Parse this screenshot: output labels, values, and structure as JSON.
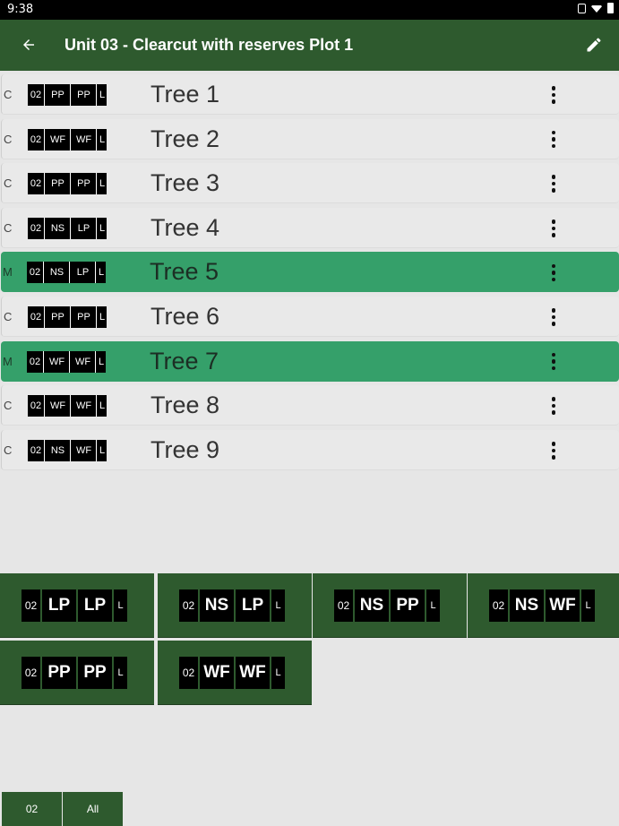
{
  "status_bar": {
    "time": "9:38"
  },
  "app_bar": {
    "title": "Unit 03 - Clearcut with reserves Plot 1"
  },
  "trees": [
    {
      "status": "C",
      "tags": [
        "02",
        "PP",
        "PP",
        "L"
      ],
      "name": "Tree 1",
      "selected": false
    },
    {
      "status": "C",
      "tags": [
        "02",
        "WF",
        "WF",
        "L"
      ],
      "name": "Tree 2",
      "selected": false
    },
    {
      "status": "C",
      "tags": [
        "02",
        "PP",
        "PP",
        "L"
      ],
      "name": "Tree 3",
      "selected": false
    },
    {
      "status": "C",
      "tags": [
        "02",
        "NS",
        "LP",
        "L"
      ],
      "name": "Tree 4",
      "selected": false
    },
    {
      "status": "M",
      "tags": [
        "02",
        "NS",
        "LP",
        "L"
      ],
      "name": "Tree 5",
      "selected": true
    },
    {
      "status": "C",
      "tags": [
        "02",
        "PP",
        "PP",
        "L"
      ],
      "name": "Tree 6",
      "selected": false
    },
    {
      "status": "M",
      "tags": [
        "02",
        "WF",
        "WF",
        "L"
      ],
      "name": "Tree 7",
      "selected": true
    },
    {
      "status": "C",
      "tags": [
        "02",
        "WF",
        "WF",
        "L"
      ],
      "name": "Tree 8",
      "selected": false
    },
    {
      "status": "C",
      "tags": [
        "02",
        "NS",
        "WF",
        "L"
      ],
      "name": "Tree 9",
      "selected": false
    }
  ],
  "combos": [
    [
      "02",
      "LP",
      "LP",
      "L"
    ],
    [
      "02",
      "NS",
      "LP",
      "L"
    ],
    [
      "02",
      "NS",
      "PP",
      "L"
    ],
    [
      "02",
      "NS",
      "WF",
      "L"
    ],
    [
      "02",
      "PP",
      "PP",
      "L"
    ],
    [
      "02",
      "WF",
      "WF",
      "L"
    ]
  ],
  "bottom_tabs": [
    "02",
    "All"
  ],
  "colors": {
    "app_bar": "#2e5a2e",
    "selected_row": "#35a06a",
    "background": "#e6e6e6",
    "tag_bg": "#000000"
  },
  "icons": {
    "back": "arrow-left-icon",
    "edit": "pencil-icon",
    "row_menu": "more-vertical-icon"
  }
}
